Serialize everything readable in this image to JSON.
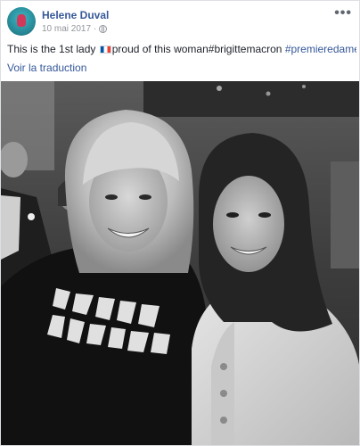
{
  "post": {
    "author": "Helene Duval",
    "date": "10 mai 2017",
    "separator": "·",
    "more_label": "•••",
    "caption_text_1": "This is the 1st lady ",
    "caption_text_2": "proud of this woman#brigittemacron ",
    "hashtag": "#premieredame",
    "translate_label": "Voir la traduction"
  },
  "icons": {
    "privacy": "globe-icon",
    "flag": "france-flag-icon",
    "menu": "more-options-icon"
  },
  "colors": {
    "link": "#365899",
    "text": "#1d2129",
    "meta": "#90949c"
  }
}
